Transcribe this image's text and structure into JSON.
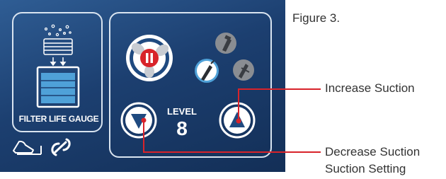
{
  "figure_caption": "Figure 3.",
  "filter": {
    "gauge_label": "FILTER LIFE GAUGE"
  },
  "controls": {
    "level_label": "LEVEL",
    "level_value": "8"
  },
  "callouts": {
    "increase": "Increase Suction",
    "decrease": "Decrease Suction",
    "setting": "Suction Setting"
  },
  "colors": {
    "panel": "#1f4a80",
    "accent_red": "#d8232a",
    "icon_white": "#ffffff",
    "icon_gray": "#8a8d92"
  }
}
